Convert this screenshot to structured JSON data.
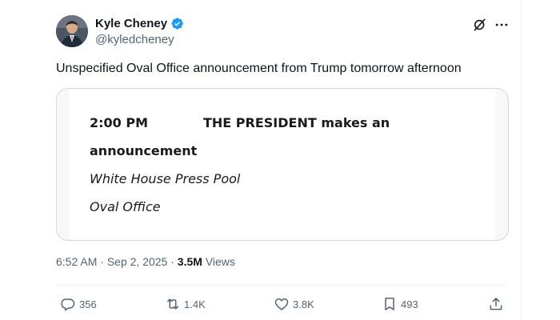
{
  "author": {
    "display_name": "Kyle Cheney",
    "handle": "@kyledcheney",
    "verified": true
  },
  "tweet": {
    "text": "Unspecified Oval Office announcement from Trump tomorrow afternoon"
  },
  "schedule_image": {
    "time": "2:00 PM",
    "event_line1": "THE PRESIDENT makes an",
    "event_line2": "announcement",
    "coverage": "White House Press Pool",
    "location": "Oval Office"
  },
  "meta": {
    "time": "6:52 AM",
    "separator": "·",
    "date": "Sep 2, 2025",
    "views_count": "3.5M",
    "views_label": "Views"
  },
  "actions": {
    "replies": "356",
    "reposts": "1.4K",
    "likes": "3.8K",
    "bookmarks": "493"
  },
  "colors": {
    "text": "#0f1419",
    "secondary": "#536471",
    "verified": "#1d9bf0",
    "border": "#cfd9de"
  },
  "icons": [
    "verified-badge-icon",
    "grok-icon",
    "more-icon",
    "reply-icon",
    "repost-icon",
    "like-icon",
    "bookmark-icon",
    "share-icon"
  ]
}
